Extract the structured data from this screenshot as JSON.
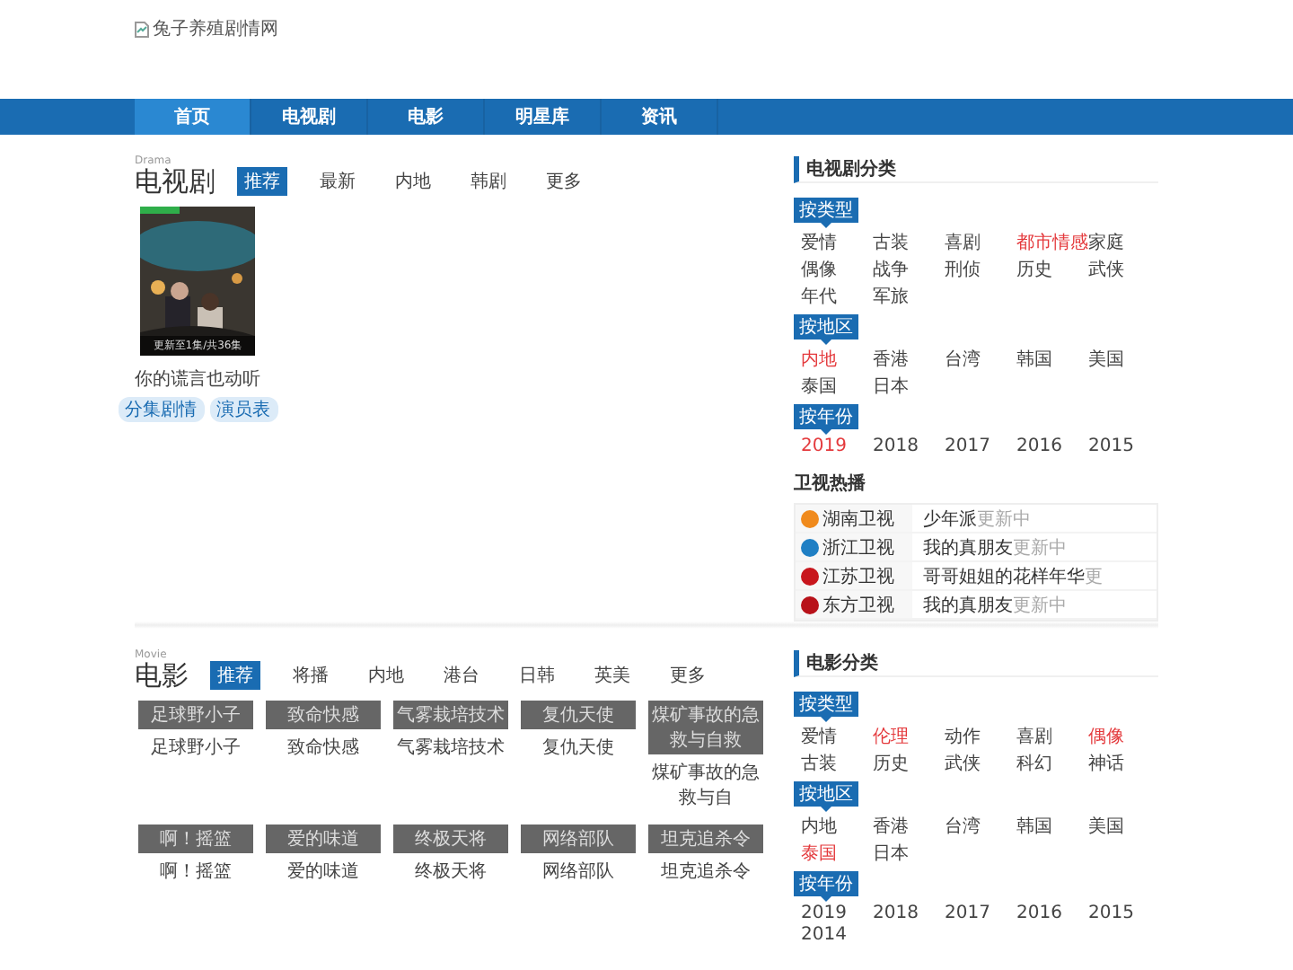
{
  "logo": {
    "alt": "兔子养殖剧情网"
  },
  "nav": [
    {
      "label": "首页",
      "selected": true
    },
    {
      "label": "电视剧",
      "selected": false
    },
    {
      "label": "电影",
      "selected": false
    },
    {
      "label": "明星库",
      "selected": false
    },
    {
      "label": "资讯",
      "selected": false
    }
  ],
  "tv_section": {
    "title_en": "Drama",
    "title": "电视剧",
    "tabs": [
      {
        "label": "推荐",
        "selected": true
      },
      {
        "label": "最新",
        "selected": false
      },
      {
        "label": "内地",
        "selected": false
      },
      {
        "label": "韩剧",
        "selected": false
      },
      {
        "label": "更多",
        "selected": false
      }
    ],
    "shows": [
      {
        "kind": "picture",
        "badge": "更新至1集/共36集",
        "title": "你的谎言也动听",
        "links": [
          "分集剧情",
          "演员表"
        ]
      }
    ]
  },
  "tv_sidebar": {
    "title": "电视剧分类",
    "filters": [
      {
        "label": "按类型",
        "items": [
          {
            "label": "爱情",
            "selected": false
          },
          {
            "label": "古装",
            "selected": false
          },
          {
            "label": "喜剧",
            "selected": false
          },
          {
            "label": "都市情感",
            "selected": true
          },
          {
            "label": "家庭",
            "selected": false
          },
          {
            "label": "偶像",
            "selected": false
          },
          {
            "label": "战争",
            "selected": false
          },
          {
            "label": "刑侦",
            "selected": false
          },
          {
            "label": "历史",
            "selected": false
          },
          {
            "label": "武侠",
            "selected": false
          },
          {
            "label": "年代",
            "selected": false
          },
          {
            "label": "军旅",
            "selected": false
          }
        ]
      },
      {
        "label": "按地区",
        "items": [
          {
            "label": "内地",
            "selected": true
          },
          {
            "label": "香港",
            "selected": false
          },
          {
            "label": "台湾",
            "selected": false
          },
          {
            "label": "韩国",
            "selected": false
          },
          {
            "label": "美国",
            "selected": false
          },
          {
            "label": "泰国",
            "selected": false
          },
          {
            "label": "日本",
            "selected": false
          }
        ]
      },
      {
        "label": "按年份",
        "items": [
          {
            "label": "2019",
            "selected": true
          },
          {
            "label": "2018",
            "selected": false
          },
          {
            "label": "2017",
            "selected": false
          },
          {
            "label": "2016",
            "selected": false
          },
          {
            "label": "2015",
            "selected": false
          }
        ]
      }
    ],
    "hot_title": "卫视热播",
    "hot": [
      {
        "channel": "湖南卫视",
        "color": "#f08a1c",
        "show": "少年派",
        "status": "更新中"
      },
      {
        "channel": "浙江卫视",
        "color": "#1f7fc4",
        "show": "我的真朋友",
        "status": "更新中"
      },
      {
        "channel": "江苏卫视",
        "color": "#c8161d",
        "show": "哥哥姐姐的花样年华",
        "status": "更"
      },
      {
        "channel": "东方卫视",
        "color": "#b8121a",
        "show": "我的真朋友",
        "status": "更新中"
      }
    ]
  },
  "movie_section": {
    "title_en": "Movie",
    "title": "电影",
    "tabs": [
      {
        "label": "推荐",
        "selected": true
      },
      {
        "label": "将播",
        "selected": false
      },
      {
        "label": "内地",
        "selected": false
      },
      {
        "label": "港台",
        "selected": false
      },
      {
        "label": "日韩",
        "selected": false
      },
      {
        "label": "英美",
        "selected": false
      },
      {
        "label": "更多",
        "selected": false
      }
    ],
    "movies": [
      {
        "alt": "足球野小子",
        "title": "足球野小子"
      },
      {
        "alt": "致命快感",
        "title": "致命快感"
      },
      {
        "alt": "气雾栽培技术",
        "title": "气雾栽培技术"
      },
      {
        "alt": "复仇天使",
        "title": "复仇天使"
      },
      {
        "alt": "煤矿事故的急救与自救",
        "title": "煤矿事故的急救与自"
      },
      {
        "alt": "啊！摇篮",
        "title": "啊！摇篮"
      },
      {
        "alt": "爱的味道",
        "title": "爱的味道"
      },
      {
        "alt": "终极天将",
        "title": "终极天将"
      },
      {
        "alt": "网络部队",
        "title": "网络部队"
      },
      {
        "alt": "坦克追杀令",
        "title": "坦克追杀令"
      }
    ]
  },
  "movie_sidebar": {
    "title": "电影分类",
    "filters": [
      {
        "label": "按类型",
        "items": [
          {
            "label": "爱情",
            "selected": false
          },
          {
            "label": "伦理",
            "selected": true
          },
          {
            "label": "动作",
            "selected": false
          },
          {
            "label": "喜剧",
            "selected": false
          },
          {
            "label": "偶像",
            "selected": true
          },
          {
            "label": "古装",
            "selected": false
          },
          {
            "label": "历史",
            "selected": false
          },
          {
            "label": "武侠",
            "selected": false
          },
          {
            "label": "科幻",
            "selected": false
          },
          {
            "label": "神话",
            "selected": false
          }
        ]
      },
      {
        "label": "按地区",
        "items": [
          {
            "label": "内地",
            "selected": false
          },
          {
            "label": "香港",
            "selected": false
          },
          {
            "label": "台湾",
            "selected": false
          },
          {
            "label": "韩国",
            "selected": false
          },
          {
            "label": "美国",
            "selected": false
          },
          {
            "label": "泰国",
            "selected": true
          },
          {
            "label": "日本",
            "selected": false
          }
        ]
      },
      {
        "label": "按年份",
        "items": [
          {
            "label": "2019",
            "selected": false
          },
          {
            "label": "2018",
            "selected": false
          },
          {
            "label": "2017",
            "selected": false
          },
          {
            "label": "2016",
            "selected": false
          },
          {
            "label": "2015",
            "selected": false
          },
          {
            "label": "2014",
            "selected": false
          }
        ]
      }
    ]
  }
}
